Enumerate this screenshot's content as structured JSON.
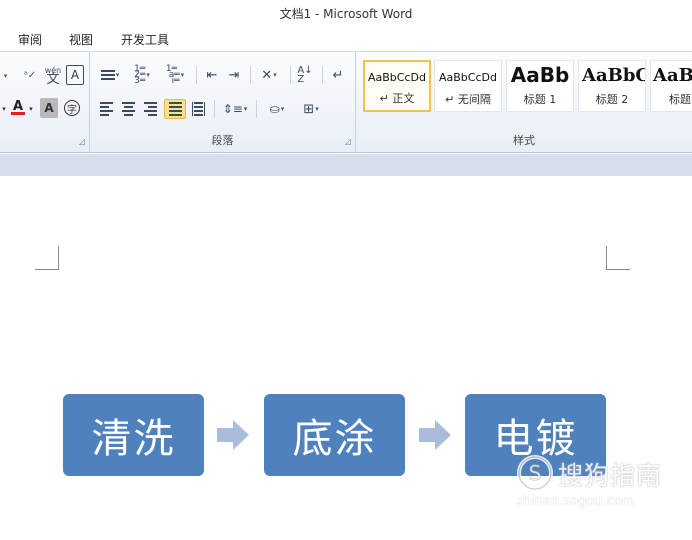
{
  "window": {
    "title": "文档1  -  Microsoft Word"
  },
  "menu": {
    "items": [
      "审阅",
      "视图",
      "开发工具"
    ]
  },
  "ribbon": {
    "font_group": {
      "phonetic_label": "wén",
      "char_border_label": "A",
      "font_color_label": "A",
      "char_shading_label": "A",
      "enclosed_char_label": "字",
      "font_color_hex": "#e02020"
    },
    "paragraph_group": {
      "label": "段落"
    },
    "styles_group": {
      "label": "样式",
      "styles": [
        {
          "sample": "AaBbCcDd",
          "name": "↵ 正文"
        },
        {
          "sample": "AaBbCcDd",
          "name": "↵ 无间隔"
        },
        {
          "sample": "AaBb",
          "name": "标题 1"
        },
        {
          "sample": "AaBbC",
          "name": "标题 2"
        },
        {
          "sample": "AaB",
          "name": "标题"
        }
      ]
    }
  },
  "document": {
    "process_steps": [
      "清洗",
      "底涂",
      "电镀"
    ],
    "box_color": "#4f81bd",
    "arrow_color": "#a9bcdc"
  },
  "watermark": {
    "main": "搜狗指南",
    "sub": "zhinan.sogou.com"
  }
}
